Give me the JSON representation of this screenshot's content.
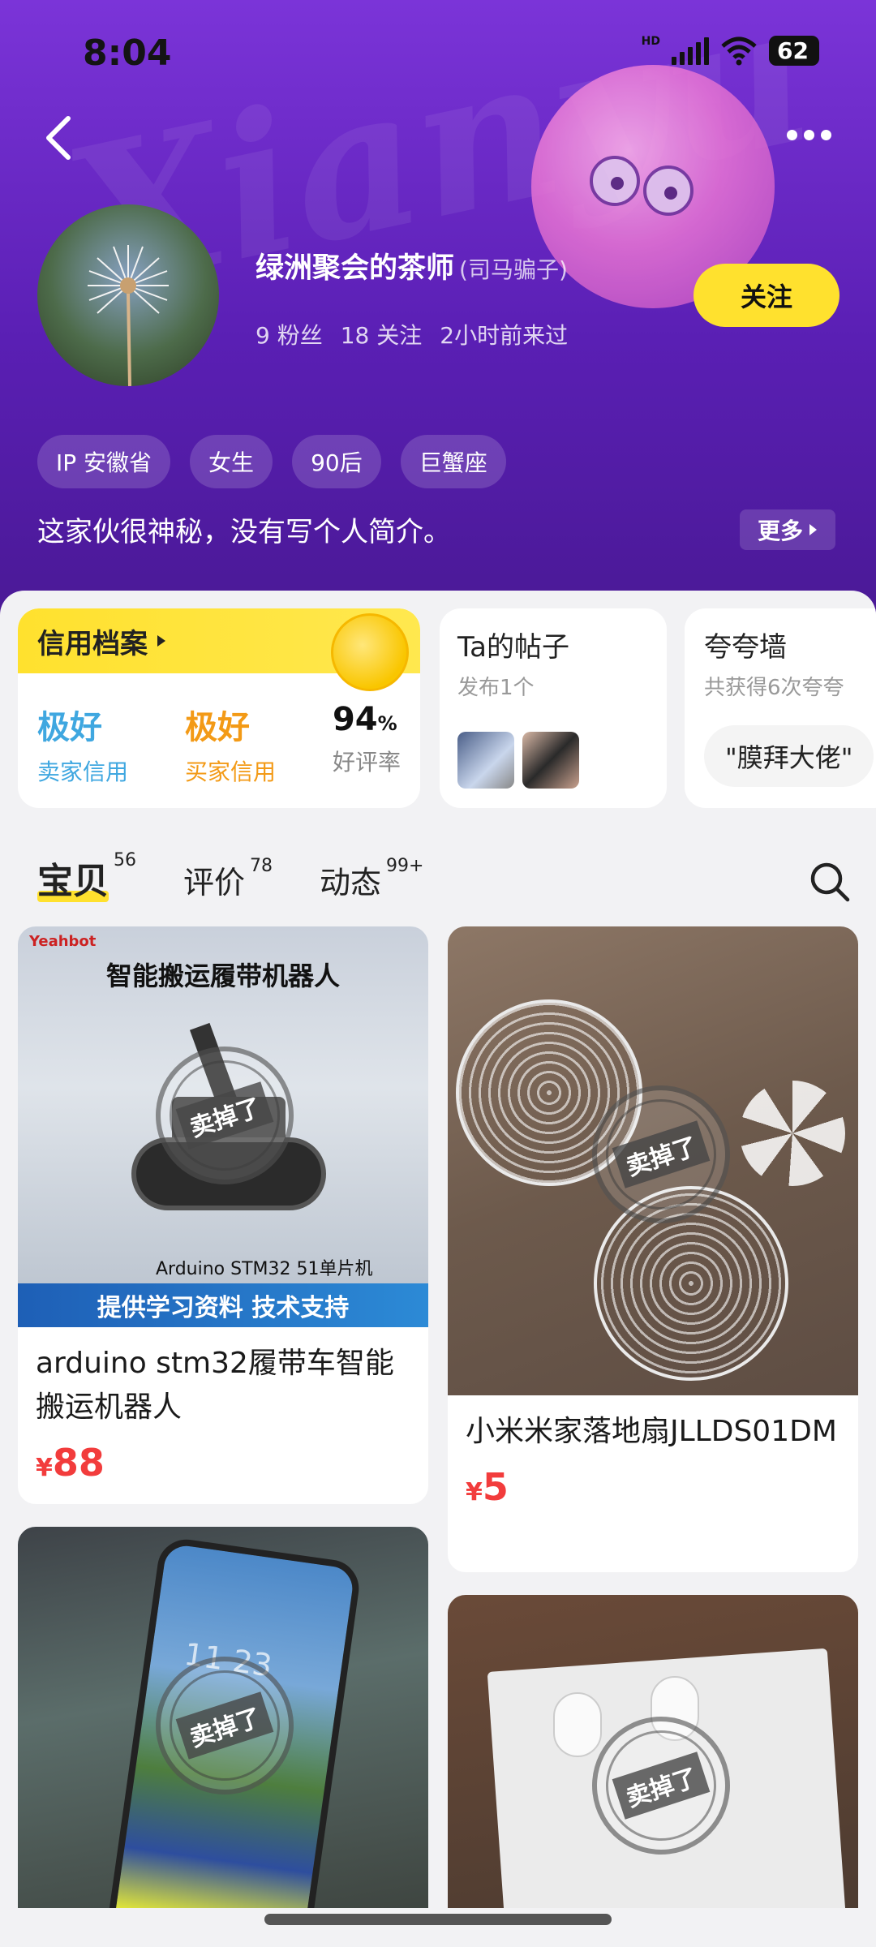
{
  "status": {
    "time": "8:04",
    "battery": "62",
    "network": "HD"
  },
  "profile": {
    "name": "绿洲聚会的茶师",
    "alias": "(司马骗子)",
    "fans": "9 粉丝",
    "following": "18 关注",
    "last_seen": "2小时前来过",
    "follow_label": "关注",
    "tags": [
      "IP 安徽省",
      "女生",
      "90后",
      "巨蟹座"
    ],
    "bio": "这家伙很神秘，没有写个人简介。",
    "more_label": "更多"
  },
  "watermark": "Xianyu",
  "credit": {
    "title": "信用档案",
    "seller": {
      "value": "极好",
      "label": "卖家信用"
    },
    "buyer": {
      "value": "极好",
      "label": "买家信用"
    },
    "rating": {
      "value": "94",
      "unit": "%",
      "label": "好评率"
    }
  },
  "posts": {
    "title": "Ta的帖子",
    "subtitle": "发布1个"
  },
  "praise_wall": {
    "title": "夸夸墙",
    "subtitle": "共获得6次夸夸",
    "quote": "\"膜拜大佬\""
  },
  "tabs": [
    {
      "label": "宝贝",
      "count": "56",
      "active": true
    },
    {
      "label": "评价",
      "count": "78",
      "active": false
    },
    {
      "label": "动态",
      "count": "99+",
      "active": false
    }
  ],
  "products": [
    {
      "title": "arduino stm32履带车智能搬运机器人",
      "price": "88",
      "sold_label": "卖掉了",
      "image_texts": {
        "brand": "Yeahbot",
        "headline": "智能搬运履带机器人",
        "subline": "Arduino STM32 51单片机",
        "banner": "提供学习资料 技术支持"
      }
    },
    {
      "title": "小米米家落地扇JLLDS01DM",
      "price": "5",
      "sold_label": "卖掉了"
    },
    {
      "title": "",
      "price": "",
      "sold_label": "卖掉了",
      "image_texts": {
        "phone_time": "11 23"
      }
    },
    {
      "title": "",
      "price": "",
      "sold_label": "卖掉了"
    }
  ],
  "currency": "¥",
  "colors": {
    "header_purple": "#6a28c8",
    "accent_yellow": "#ffe12e",
    "price_red": "#f23c3c",
    "seller_blue": "#3fa7e0",
    "buyer_orange": "#f39a16"
  }
}
